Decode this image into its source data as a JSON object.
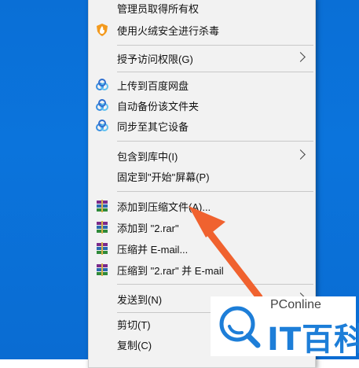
{
  "menu": {
    "items": [
      {
        "label": "管理员取得所有权"
      },
      {
        "label": "使用火绒安全进行杀毒",
        "icon": "huorong-shield-icon"
      },
      {
        "label": "授予访问权限(G)"
      },
      {
        "label": "上传到百度网盘",
        "icon": "baidu-cloud-icon"
      },
      {
        "label": "自动备份该文件夹",
        "icon": "baidu-cloud-icon"
      },
      {
        "label": "同步至其它设备",
        "icon": "baidu-cloud-icon"
      },
      {
        "label": "包含到库中(I)"
      },
      {
        "label": "固定到\"开始\"屏幕(P)"
      },
      {
        "label": "添加到压缩文件(A)...",
        "icon": "winrar-icon"
      },
      {
        "label": "添加到 \"2.rar\"",
        "icon": "winrar-icon"
      },
      {
        "label": "压缩并 E-mail...",
        "icon": "winrar-icon"
      },
      {
        "label": "压缩到 \"2.rar\" 并 E-mail",
        "icon": "winrar-icon"
      },
      {
        "label": "发送到(N)"
      },
      {
        "label": "剪切(T)"
      },
      {
        "label": "复制(C)"
      }
    ]
  },
  "watermark": {
    "brand": "PConline",
    "name": "IT百科"
  },
  "colors": {
    "desktop": "#0a6fd6",
    "menu_bg": "#f2f2f2",
    "arrow": "#f0622f",
    "logo_blue": "#1d7ed8"
  }
}
